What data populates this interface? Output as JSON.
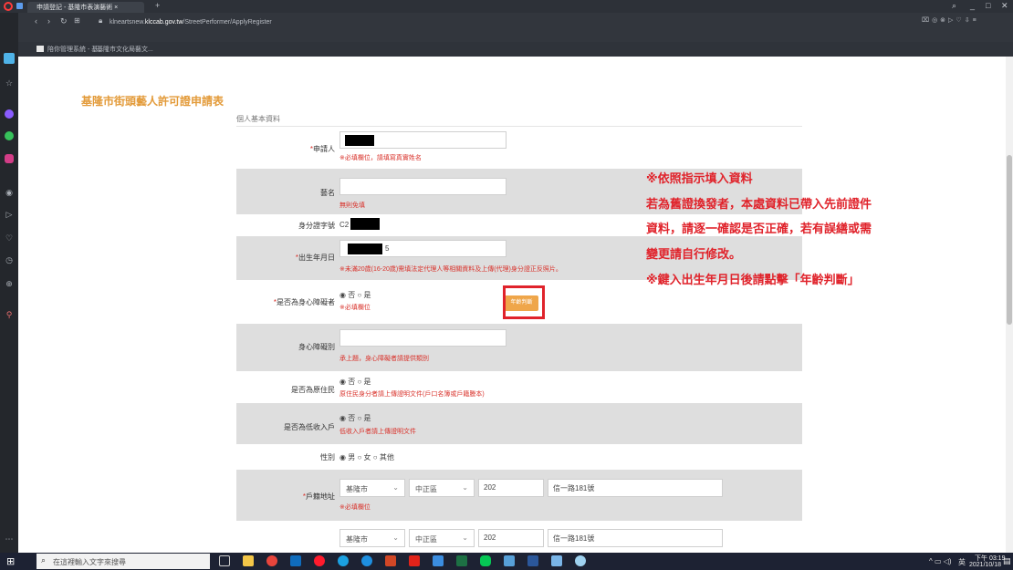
{
  "browser": {
    "tab_title": "申請登記 - 基隆市表演藝術 ×",
    "new_tab": "+",
    "url_domain_prefix": "klneartsnew.",
    "url_domain": "klccab.gov.tw",
    "url_path": "/StreetPerformer/ApplyRegister",
    "bookmark_1": "陪你管理系統 - 基...",
    "bookmark_2": "基隆市文化局藝文..."
  },
  "form": {
    "title": "基隆市街頭藝人許可證申請表",
    "section": "個人基本資料",
    "applicant": {
      "label": "申請人",
      "note": "※必填欄位，請填寫真實姓名"
    },
    "stage_name": {
      "label": "藝名",
      "note": "無則免填"
    },
    "id_number": {
      "label": "身分證字號",
      "value_visible": "C2"
    },
    "birthday": {
      "label": "出生年月日",
      "value_visible": "5",
      "age_button": "年齡判斷",
      "note": "※未滿20歲(16-20歲)需填法定代理人等相關資料及上傳(代理)身分證正反照片。"
    },
    "disability": {
      "label": "是否為身心障礙者",
      "opt_no": "否",
      "opt_yes": "是",
      "note": "※必填欄位"
    },
    "disability_type": {
      "label": "身心障礙別",
      "note": "承上題，身心障礙者請提供類別"
    },
    "indigenous": {
      "label": "是否為原住民",
      "opt_no": "否",
      "opt_yes": "是",
      "note": "原住民身分者請上傳證明文件(戶口名簿或戶籍謄本)"
    },
    "low_income": {
      "label": "是否為低收入戶",
      "opt_no": "否",
      "opt_yes": "是",
      "note": "低收入戶者請上傳證明文件"
    },
    "gender": {
      "label": "性別",
      "opt_male": "男",
      "opt_female": "女",
      "opt_other": "其他"
    },
    "household_address": {
      "label": "戶籍地址",
      "city": "基隆市",
      "district": "中正區",
      "zip": "202",
      "street": "信一路181號",
      "note": "※必填欄位"
    },
    "mailing_address": {
      "city": "基隆市",
      "district": "中正區",
      "zip": "202",
      "street": "信一路181號"
    }
  },
  "overlay": {
    "line1": "※依照指示填入資料",
    "line2": "若為舊證換發者，本處資料已帶入先前證件",
    "line3": "資料，請逐一確認是否正確，若有誤繕或需",
    "line4": "變更請自行修改。",
    "line5": "※鍵入出生年月日後請點擊「年齡判斷」"
  },
  "taskbar": {
    "search_placeholder": "在這裡輸入文字來搜尋",
    "time": "下午 03:19",
    "date": "2021/10/18",
    "ime": "英"
  }
}
